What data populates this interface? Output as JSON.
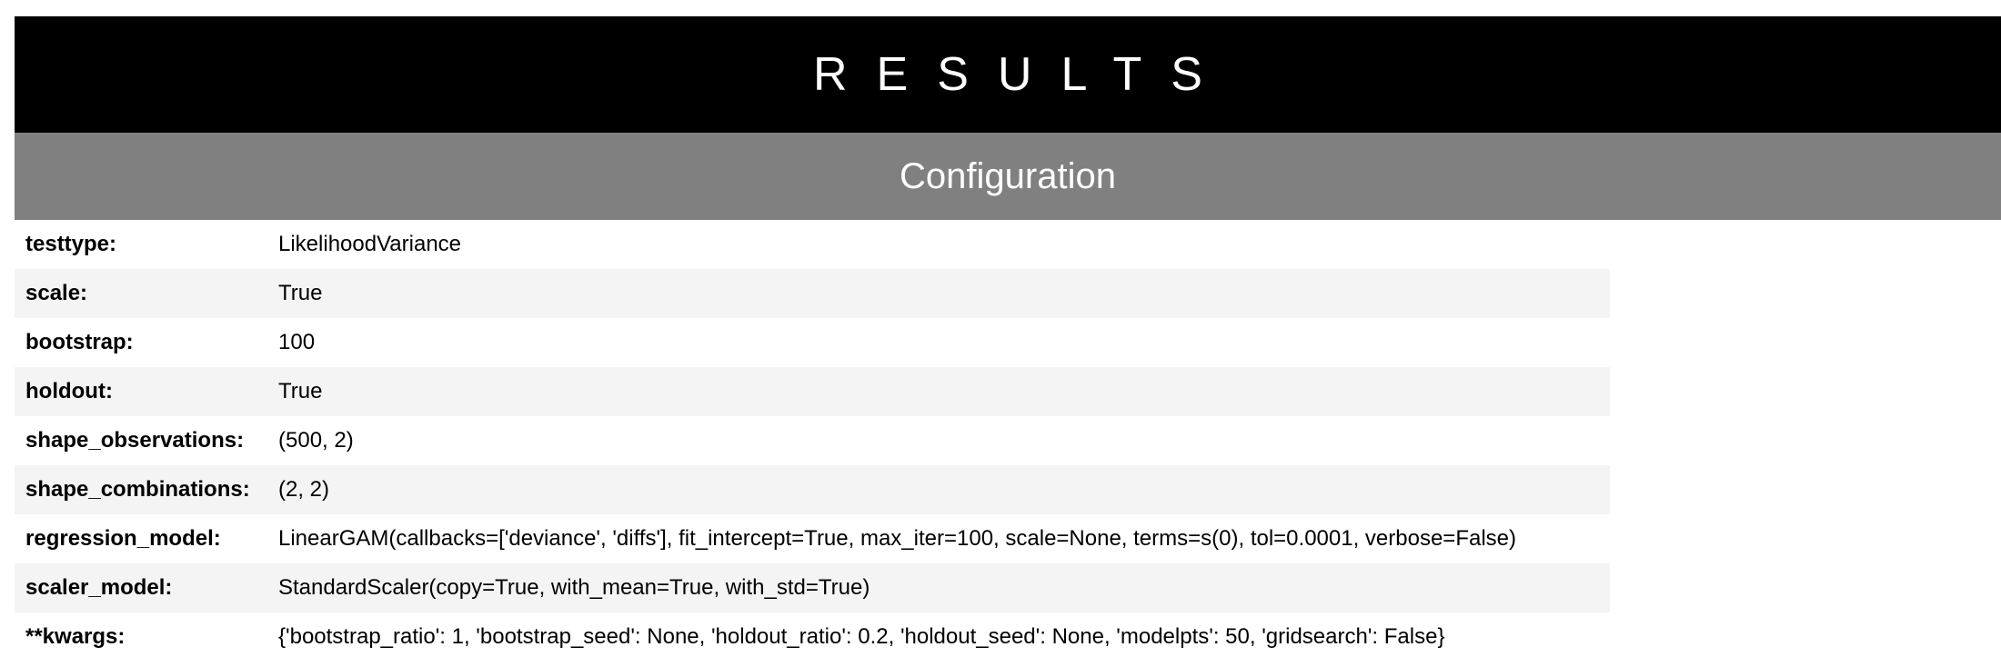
{
  "header": {
    "title": "RESULTS",
    "section": "Configuration"
  },
  "config": {
    "rows": [
      {
        "key": "testtype:",
        "value": "LikelihoodVariance"
      },
      {
        "key": "scale:",
        "value": "True"
      },
      {
        "key": "bootstrap:",
        "value": "100"
      },
      {
        "key": "holdout:",
        "value": "True"
      },
      {
        "key": "shape_observations:",
        "value": "(500, 2)"
      },
      {
        "key": "shape_combinations:",
        "value": "(2, 2)"
      },
      {
        "key": "regression_model:",
        "value": "LinearGAM(callbacks=['deviance', 'diffs'], fit_intercept=True, max_iter=100, scale=None, terms=s(0), tol=0.0001, verbose=False)"
      },
      {
        "key": "scaler_model:",
        "value": "StandardScaler(copy=True, with_mean=True, with_std=True)"
      },
      {
        "key": "**kwargs:",
        "value": "{'bootstrap_ratio': 1, 'bootstrap_seed': None, 'holdout_ratio': 0.2, 'holdout_seed': None, 'modelpts': 50, 'gridsearch': False}"
      }
    ]
  },
  "colors": {
    "title_background": "#000000",
    "section_background": "#808080",
    "stripe": "#f4f4f4"
  }
}
